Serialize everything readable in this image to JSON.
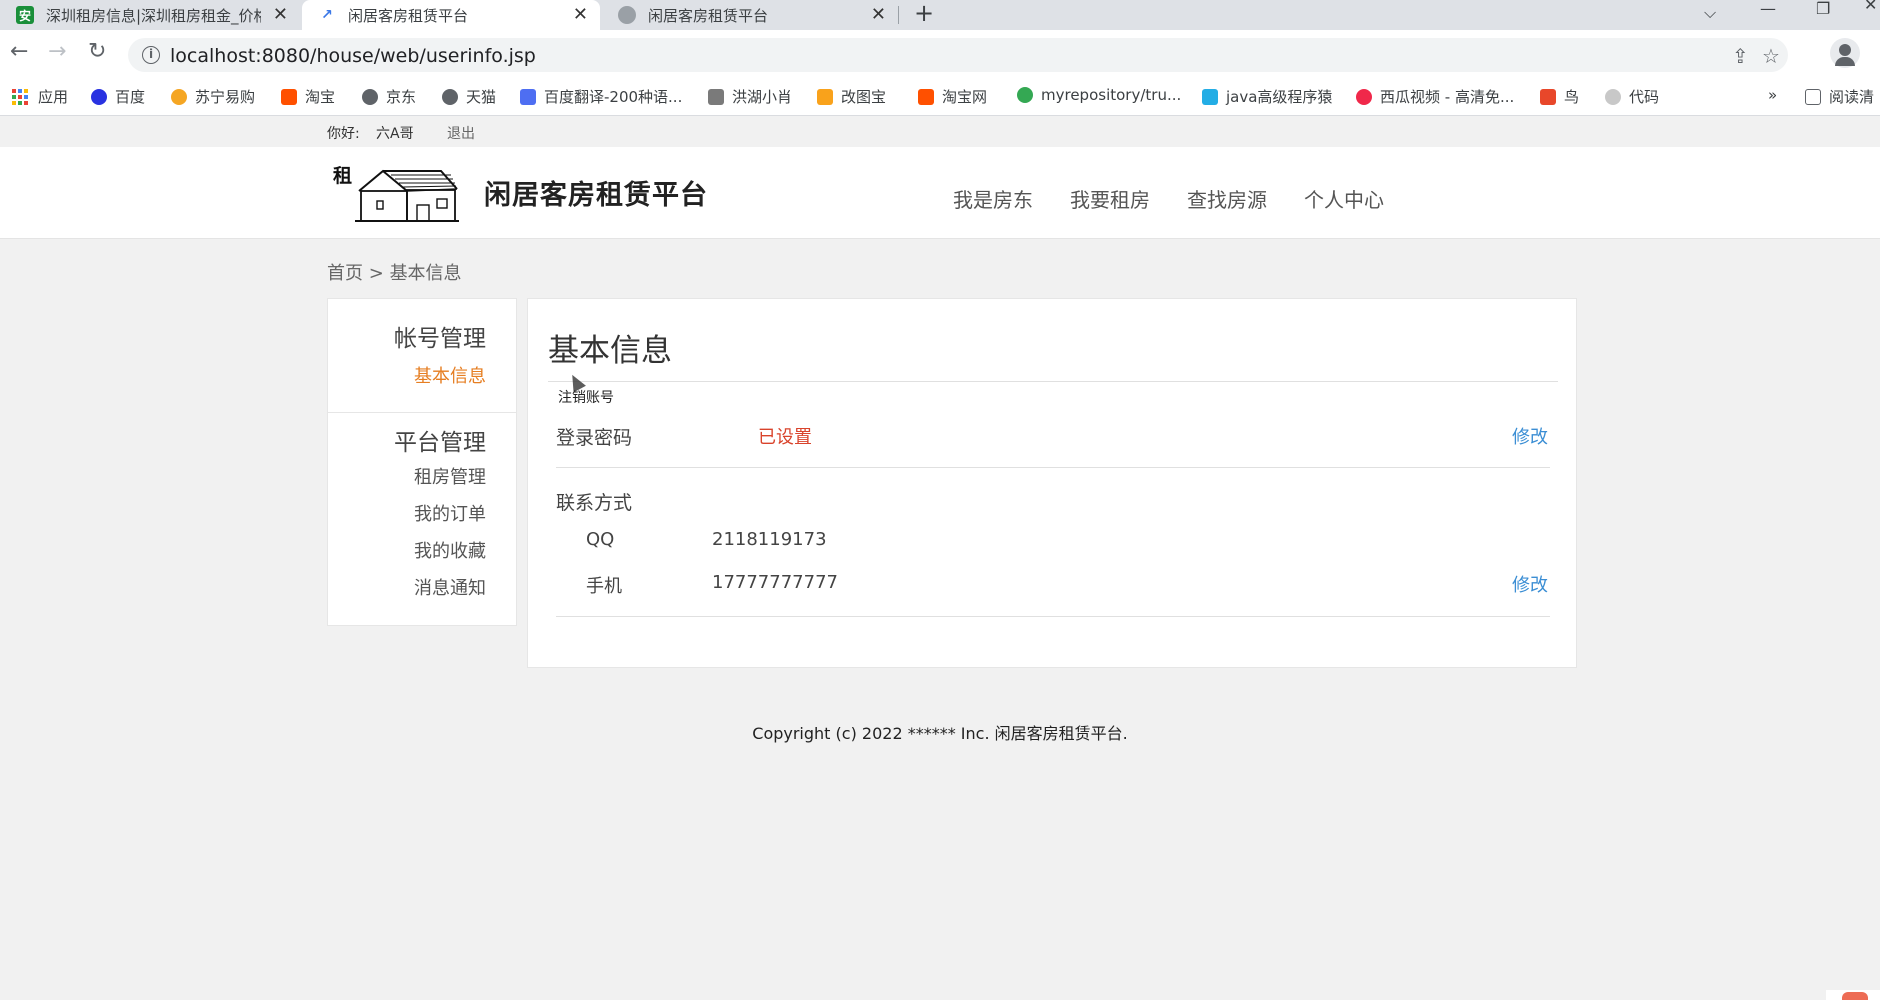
{
  "browser": {
    "tabs": [
      {
        "title": "深圳租房信息|深圳租房租金_价格",
        "favicon_color": "#1a8f3a",
        "favicon_glyph": "安",
        "active": false
      },
      {
        "title": "闲居客房租赁平台",
        "favicon_color": "#3b78e7",
        "favicon_glyph": "📈",
        "active": true
      },
      {
        "title": "闲居客房租赁平台",
        "favicon_color": "#9aa0a6",
        "favicon_glyph": "🌐",
        "active": false
      }
    ],
    "close_glyph": "✕",
    "new_tab_glyph": "+",
    "window_controls": [
      "⌵",
      "—",
      "❐",
      "✕"
    ],
    "nav": {
      "back": "←",
      "forward": "→",
      "reload": "↻"
    },
    "url": "localhost:8080/house/web/userinfo.jsp",
    "info_glyph": "i",
    "omni_icons": {
      "share": "⇪",
      "star": "☆"
    },
    "bookmarks": [
      {
        "label": "应用",
        "icon": "apps-grid-icon",
        "color": "#4285f4"
      },
      {
        "label": "百度",
        "icon": "baidu-paw-icon",
        "color": "#2932e1"
      },
      {
        "label": "苏宁易购",
        "icon": "suning-icon",
        "color": "#f5a623"
      },
      {
        "label": "淘宝",
        "icon": "taobao-icon",
        "color": "#ff5000"
      },
      {
        "label": "京东",
        "icon": "globe-icon",
        "color": "#5f6368"
      },
      {
        "label": "天猫",
        "icon": "globe-icon",
        "color": "#5f6368"
      },
      {
        "label": "百度翻译-200种语...",
        "icon": "translate-icon",
        "color": "#4e6ef2"
      },
      {
        "label": "洪湖小肖",
        "icon": "bird-icon",
        "color": "#7a7a7a"
      },
      {
        "label": "改图宝",
        "icon": "gaitubao-icon",
        "color": "#f9a21b"
      },
      {
        "label": "淘宝网",
        "icon": "taobao-icon",
        "color": "#ff5000"
      },
      {
        "label": "myrepository/tru...",
        "icon": "chrome-icon",
        "color": "#34a853"
      },
      {
        "label": "java高级程序猿",
        "icon": "bilibili-icon",
        "color": "#23ade5"
      },
      {
        "label": "西瓜视频 - 高清免...",
        "icon": "xigua-icon",
        "color": "#f0284a"
      },
      {
        "label": "鸟",
        "icon": "bird-red-icon",
        "color": "#e8472a"
      },
      {
        "label": "代码",
        "icon": "folder-icon",
        "color": "#c8c8c8"
      }
    ],
    "bookmarks_more": "»",
    "reading_list": "阅读清"
  },
  "topbar": {
    "greeting": "你好:",
    "username": "六A哥",
    "logout": "退出"
  },
  "header": {
    "logo_char": "租",
    "site_name": "闲居客房租赁平台",
    "nav": [
      "我是房东",
      "我要租房",
      "查找房源",
      "个人中心"
    ]
  },
  "breadcrumb": {
    "home": "首页",
    "sep": ">",
    "current": "基本信息"
  },
  "sidebar": {
    "account_group": "帐号管理",
    "account_items": [
      {
        "label": "基本信息",
        "active": true
      }
    ],
    "platform_group": "平台管理",
    "platform_items": [
      {
        "label": "租房管理"
      },
      {
        "label": "我的订单"
      },
      {
        "label": "我的收藏"
      },
      {
        "label": "消息通知"
      }
    ]
  },
  "main": {
    "title": "基本信息",
    "tooltip": "注销账号",
    "password": {
      "label": "登录密码",
      "status": "已设置",
      "edit": "修改"
    },
    "contact": {
      "label": "联系方式",
      "qq_label": "QQ",
      "qq_value": "2118119173",
      "phone_label": "手机",
      "phone_value": "17777777777",
      "edit": "修改"
    }
  },
  "footer": {
    "copyright": "Copyright (c) 2022 ****** Inc. 闲居客房租赁平台."
  }
}
